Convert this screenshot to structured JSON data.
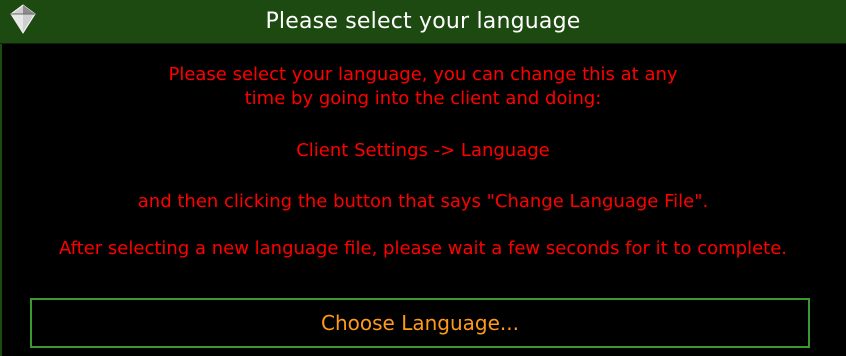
{
  "window": {
    "title": "Please select your language",
    "icon": "diamond-app-icon"
  },
  "message": {
    "line1": "Please select your language, you can change this at any",
    "line2": "time by going into the client and doing:",
    "path": "Client Settings -> Language",
    "line3": "and then clicking the button that says \"Change Language File\".",
    "line4": "After selecting a new language file, please wait a few seconds for it to complete."
  },
  "button": {
    "label": "Choose Language..."
  },
  "colors": {
    "titlebar": "#1d4a10",
    "message_text": "#ff0000",
    "button_text": "#ff9a1a",
    "button_border": "#3a9a30"
  }
}
